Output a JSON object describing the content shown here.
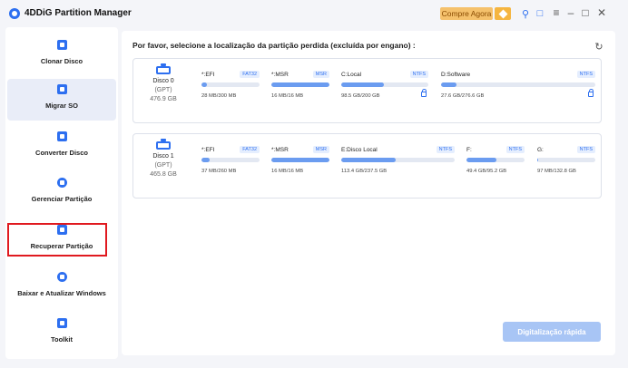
{
  "app": {
    "title": "4DDiG Partition Manager",
    "buy_label": "Compre Agora",
    "accent": "#2d6ff0"
  },
  "icons": {
    "logo": "logo-icon",
    "diamond": "diamond-icon",
    "tool": "key-icon",
    "feedback": "chat-icon",
    "menu": "menu-icon",
    "minimize": "minimize-icon",
    "maximize": "maximize-icon",
    "close": "close-icon",
    "refresh": "refresh-icon"
  },
  "sidebar": {
    "items": [
      {
        "label": "Clonar Disco",
        "icon": "clone-disk-icon"
      },
      {
        "label": "Migrar SO",
        "icon": "migrate-os-icon"
      },
      {
        "label": "Converter Disco",
        "icon": "convert-disk-icon"
      },
      {
        "label": "Gerenciar Partição",
        "icon": "partition-pie-icon"
      },
      {
        "label": "Recuperar Partição",
        "icon": "recover-partition-icon"
      },
      {
        "label": "Baixar e Atualizar Windows",
        "icon": "download-windows-icon"
      },
      {
        "label": "Toolkit",
        "icon": "toolkit-icon"
      }
    ],
    "active_index": 1
  },
  "main": {
    "title": "Por favor, selecione a localização da partição perdida (excluída por engano) :",
    "scan_label": "Digitalização rápida",
    "disks": [
      {
        "name": "Disco 0",
        "type": "(GPT)",
        "size": "476.9 GB",
        "partitions": [
          {
            "name": "*:EFI",
            "fs": "FAT32",
            "usage": "28 MB/300 MB",
            "fill": 0.09,
            "locked": false
          },
          {
            "name": "*:MSR",
            "fs": "MSR",
            "usage": "16 MB/16 MB",
            "fill": 1.0,
            "locked": false
          },
          {
            "name": "C:Local",
            "fs": "NTFS",
            "usage": "98.5 GB/200 GB",
            "fill": 0.49,
            "locked": true
          },
          {
            "name": "D:Software",
            "fs": "NTFS",
            "usage": "27.6 GB/276.6 GB",
            "fill": 0.1,
            "locked": true
          }
        ]
      },
      {
        "name": "Disco 1",
        "type": "(GPT)",
        "size": "465.8 GB",
        "partitions": [
          {
            "name": "*:EFI",
            "fs": "FAT32",
            "usage": "37 MB/260 MB",
            "fill": 0.14,
            "locked": false
          },
          {
            "name": "*:MSR",
            "fs": "MSR",
            "usage": "16 MB/16 MB",
            "fill": 1.0,
            "locked": false
          },
          {
            "name": "E:Disco Local",
            "fs": "NTFS",
            "usage": "113.4 GB/237.5 GB",
            "fill": 0.48,
            "locked": false
          },
          {
            "name": "F:",
            "fs": "NTFS",
            "usage": "49.4 GB/95.2 GB",
            "fill": 0.52,
            "locked": false
          },
          {
            "name": "G:",
            "fs": "NTFS",
            "usage": "97 MB/132.8 GB",
            "fill": 0.01,
            "locked": false
          }
        ]
      }
    ]
  }
}
